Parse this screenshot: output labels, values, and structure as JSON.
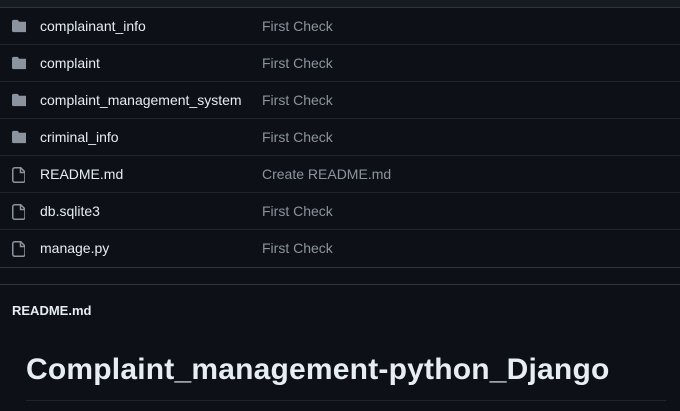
{
  "files": [
    {
      "name": "complainant_info",
      "commit": "First Check",
      "icon": "folder-icon"
    },
    {
      "name": "complaint",
      "commit": "First Check",
      "icon": "folder-icon"
    },
    {
      "name": "complaint_management_system",
      "commit": "First Check",
      "icon": "folder-icon"
    },
    {
      "name": "criminal_info",
      "commit": "First Check",
      "icon": "folder-icon"
    },
    {
      "name": "README.md",
      "commit": "Create README.md",
      "icon": "file-icon"
    },
    {
      "name": "db.sqlite3",
      "commit": "First Check",
      "icon": "file-icon"
    },
    {
      "name": "manage.py",
      "commit": "First Check",
      "icon": "file-icon"
    }
  ],
  "readme": {
    "label": "README.md",
    "title": "Complaint_management-python_Django"
  },
  "colors": {
    "background": "#0d1117",
    "text": "#e6edf3",
    "muted": "#8b949e",
    "icon": "#8b949e",
    "border": "#30363d"
  }
}
